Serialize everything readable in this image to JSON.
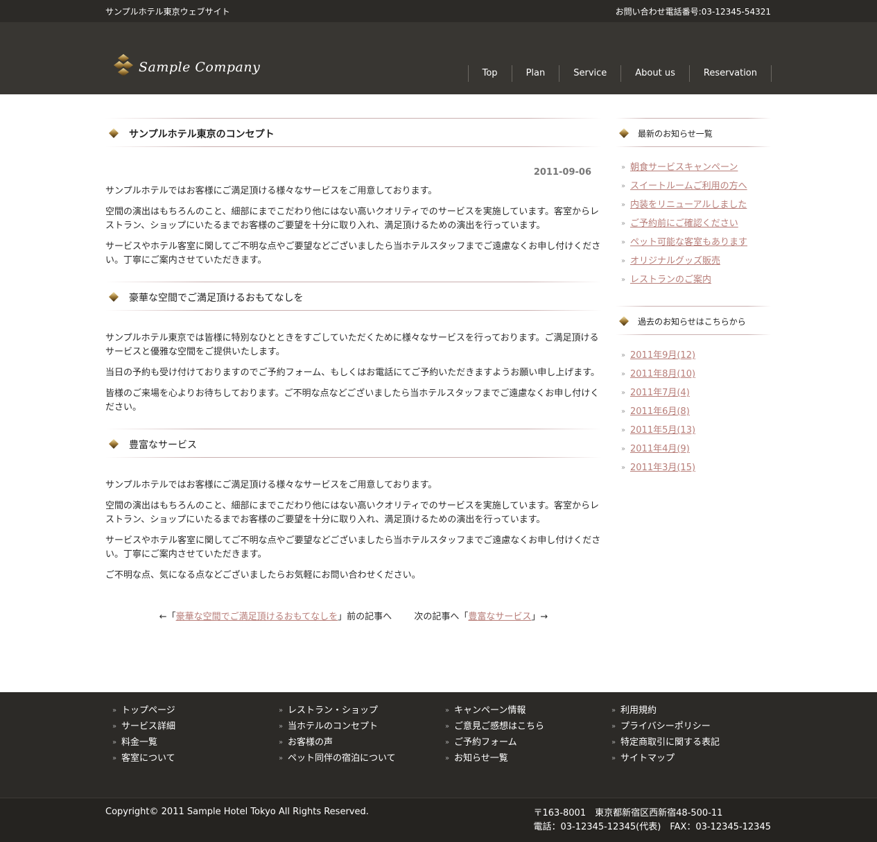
{
  "topbar": {
    "site_name": "サンプルホテル東京ウェブサイト",
    "phone": "お問い合わせ電話番号:03-12345-54321"
  },
  "header": {
    "logo_text": "Sample Company",
    "nav": [
      {
        "label": "Top"
      },
      {
        "label": "Plan"
      },
      {
        "label": "Service"
      },
      {
        "label": "About us"
      },
      {
        "label": "Reservation"
      }
    ]
  },
  "main": {
    "title": "サンプルホテル東京のコンセプト",
    "date": "2011-09-06",
    "intro": [
      "サンプルホテルではお客様にご満足頂ける様々なサービスをご用意しております。",
      "空間の演出はもちろんのこと、細部にまでこだわり他にはない高いクオリティでのサービスを実施しています。客室からレストラン、ショップにいたるまでお客様のご要望を十分に取り入れ、満足頂けるための演出を行っています。",
      "サービスやホテル客室に関してご不明な点やご要望などございましたら当ホテルスタッフまでご遠慮なくお申し付けください。丁寧にご案内させていただきます。"
    ],
    "section2": {
      "title": "豪華な空間でご満足頂けるおもてなしを",
      "paragraphs": [
        "サンプルホテル東京では皆様に特別なひとときをすごしていただくために様々なサービスを行っております。ご満足頂けるサービスと優雅な空間をご提供いたします。",
        "当日の予約も受け付けておりますのでご予約フォーム、もしくはお電話にてご予約いただきますようお願い申し上げます。",
        "皆様のご来場を心よりお待ちしております。ご不明な点などございましたら当ホテルスタッフまでご遠慮なくお申し付けください。"
      ]
    },
    "section3": {
      "title": "豊富なサービス",
      "paragraphs": [
        "サンプルホテルではお客様にご満足頂ける様々なサービスをご用意しております。",
        "空間の演出はもちろんのこと、細部にまでこだわり他にはない高いクオリティでのサービスを実施しています。客室からレストラン、ショップにいたるまでお客様のご要望を十分に取り入れ、満足頂けるための演出を行っています。",
        "サービスやホテル客室に関してご不明な点やご要望などございましたら当ホテルスタッフまでご遠慮なくお申し付けください。丁寧にご案内させていただきます。",
        "ご不明な点、気になる点などございましたらお気軽にお問い合わせください。"
      ]
    },
    "pager": {
      "prev_prefix": "←「",
      "prev_link": "豪華な空間でご満足頂けるおもてなしを",
      "prev_suffix": "」前の記事へ",
      "next_prefix": "次の記事へ「",
      "next_link": "豊富なサービス",
      "next_suffix": "」→"
    }
  },
  "sidebar": {
    "news_title": "最新のお知らせ一覧",
    "news": [
      "朝食サービスキャンペーン",
      "スイートルームご利用の方へ",
      "内装をリニューアルしました",
      "ご予約前にご確認ください",
      "ペット可能な客室もあります",
      "オリジナルグッズ販売",
      "レストランのご案内"
    ],
    "archive_title": "過去のお知らせはこちらから",
    "archive": [
      "2011年9月(12)",
      "2011年8月(10)",
      "2011年7月(4)",
      "2011年6月(8)",
      "2011年5月(13)",
      "2011年4月(9)",
      "2011年3月(15)"
    ]
  },
  "footer": {
    "columns": [
      [
        "トップページ",
        "サービス詳細",
        "料金一覧",
        "客室について"
      ],
      [
        "レストラン・ショップ",
        "当ホテルのコンセプト",
        "お客様の声",
        "ペット同伴の宿泊について"
      ],
      [
        "キャンペーン情報",
        "ご意見ご感想はこちら",
        "ご予約フォーム",
        "お知らせ一覧"
      ],
      [
        "利用規約",
        "プライバシーポリシー",
        "特定商取引に関する表記",
        "サイトマップ"
      ]
    ],
    "copyright": "Copyright© 2011 Sample Hotel Tokyo All Rights Reserved.",
    "address": "〒163-8001　東京都新宿区西新宿48-500-11",
    "contact": "電話：03-12345-12345(代表)　FAX：03-12345-12345"
  }
}
